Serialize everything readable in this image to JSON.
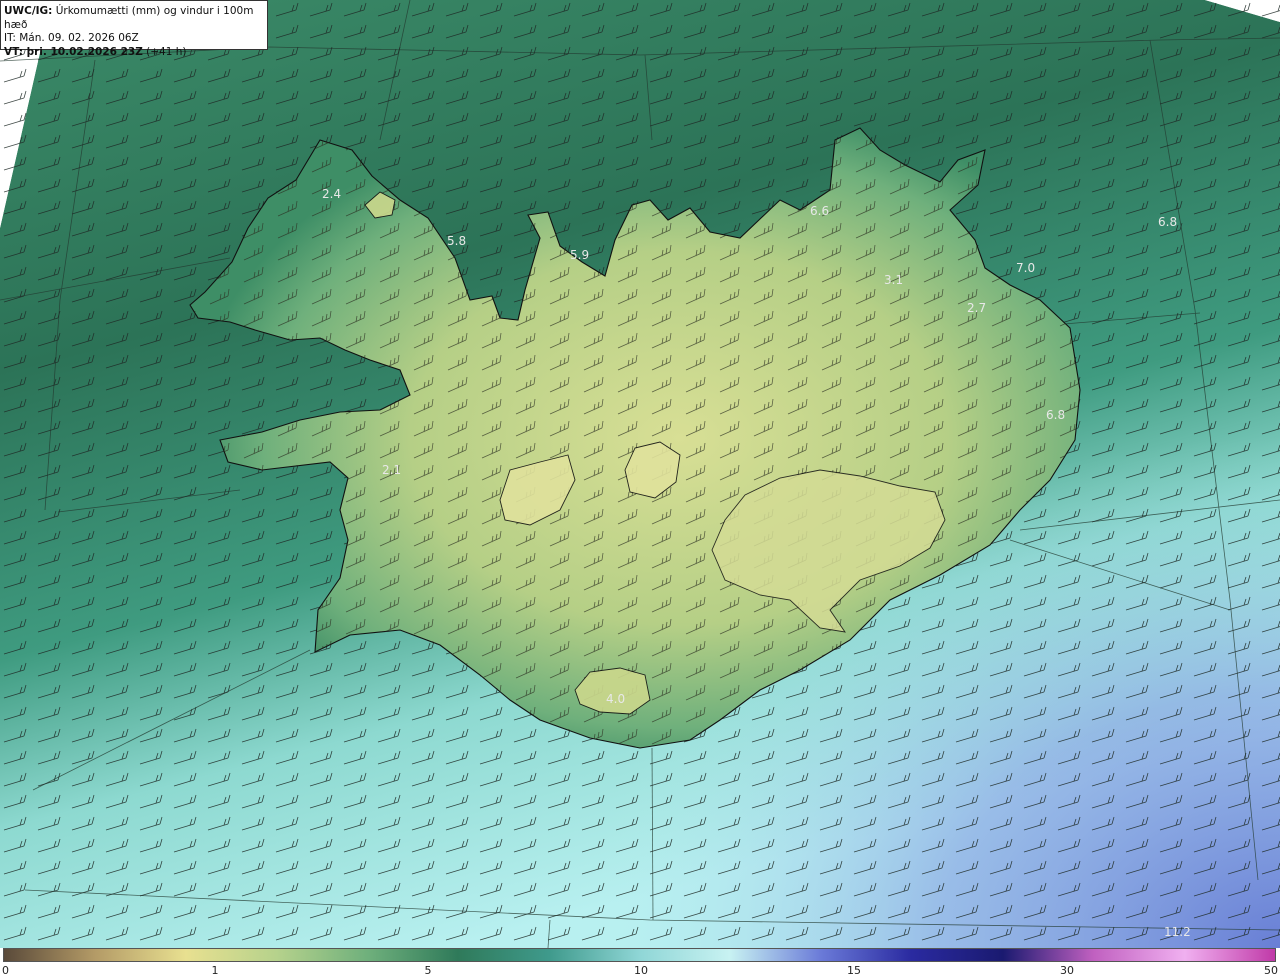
{
  "header": {
    "line1_bold": "UWC/IG:",
    "line1_text": " Úrkomumætti (mm) og vindur i 100m hæð",
    "line2": "IT: Mán. 09. 02. 2026 06Z",
    "line3_bold": "VT: þri. 10.02.2026 23Z",
    "line3_text": " (+41 h)"
  },
  "value_labels": [
    "2.4",
    "5.8",
    "5.9",
    "6.6",
    "6.8",
    "7.0",
    "3.1",
    "2.7",
    "6.8",
    "2.1",
    "4.0",
    "11.2"
  ],
  "colorbar": {
    "ticks": [
      "0",
      "1",
      "5",
      "10",
      "15",
      "30",
      "50"
    ],
    "colors": [
      "#5a4a3a",
      "#b39a66",
      "#e8e090",
      "#b6d28c",
      "#6fb07c",
      "#2f7a5a",
      "#3f9a8c",
      "#8fd6d6",
      "#c8f2f2",
      "#6a7ad8",
      "#2a2aa0",
      "#1a1a70",
      "#c060c0",
      "#f0b0f0",
      "#c03aa8"
    ]
  },
  "colors": {
    "sea_dark": "#2c7357",
    "sea_light": "#9ee6e6",
    "land_low": "#58a575",
    "land_high": "#d7de94"
  }
}
